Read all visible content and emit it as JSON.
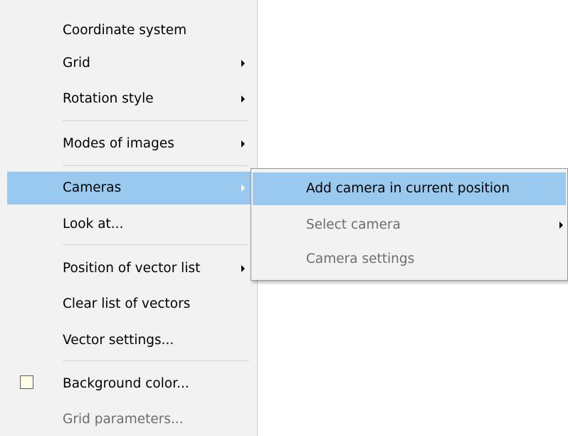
{
  "main_menu": {
    "items": [
      {
        "label": "Coordinate system",
        "has_submenu": false,
        "disabled": false
      },
      {
        "label": "Grid",
        "has_submenu": true,
        "disabled": false
      },
      {
        "label": "Rotation style",
        "has_submenu": true,
        "disabled": false
      },
      {
        "label": "Modes of images",
        "has_submenu": true,
        "disabled": false
      },
      {
        "label": "Cameras",
        "has_submenu": true,
        "disabled": false,
        "highlighted": true
      },
      {
        "label": "Look at...",
        "has_submenu": false,
        "disabled": false
      },
      {
        "label": "Position of vector list",
        "has_submenu": true,
        "disabled": false
      },
      {
        "label": "Clear list of vectors",
        "has_submenu": false,
        "disabled": false
      },
      {
        "label": "Vector settings...",
        "has_submenu": false,
        "disabled": false
      },
      {
        "label": "Background color...",
        "has_submenu": false,
        "disabled": false,
        "swatch_color": "#ffffe8"
      },
      {
        "label": "Grid parameters...",
        "has_submenu": false,
        "disabled": true
      }
    ]
  },
  "cameras_submenu": {
    "items": [
      {
        "label": "Add camera in current position",
        "has_submenu": false,
        "disabled": false,
        "highlighted": true
      },
      {
        "label": "Select camera",
        "has_submenu": true,
        "disabled": true
      },
      {
        "label": "Camera settings",
        "has_submenu": false,
        "disabled": true
      }
    ]
  },
  "colors": {
    "menu_background": "#f2f2f2",
    "highlight": "#99c9ef",
    "disabled_text": "#6d6d6d"
  }
}
